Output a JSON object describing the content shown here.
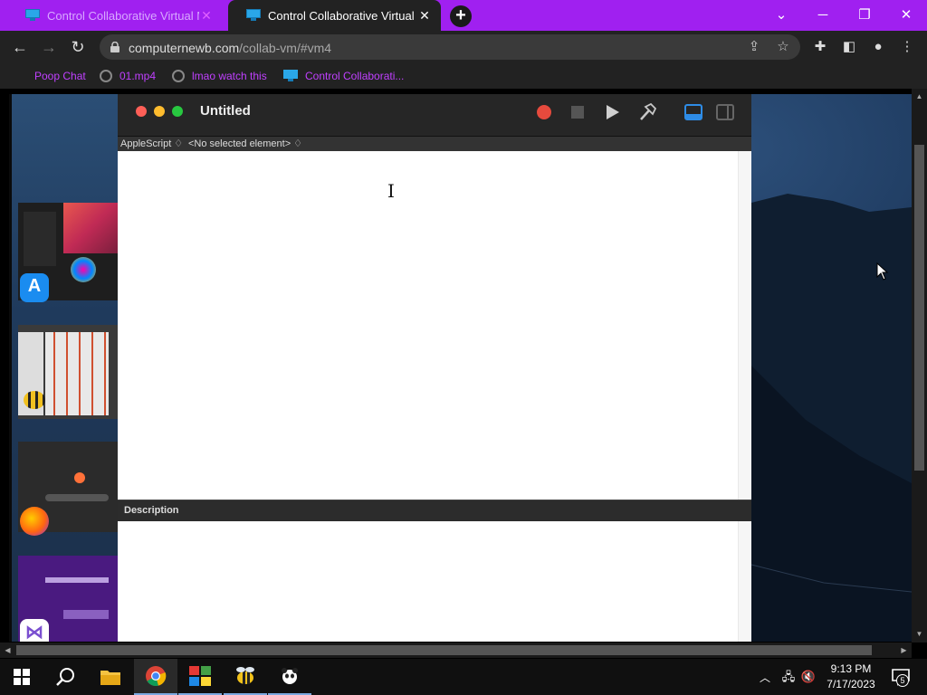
{
  "browser": {
    "tabs": [
      {
        "title": "Control Collaborative Virtual Ma",
        "active": false
      },
      {
        "title": "Control Collaborative Virtual Ma",
        "active": true
      }
    ],
    "url_host": "computernewb.com",
    "url_path": "/collab-vm/#vm4",
    "bookmarks": [
      {
        "label": "Poop Chat",
        "icon": "none"
      },
      {
        "label": "01.mp4",
        "icon": "globe-icon"
      },
      {
        "label": "lmao watch this",
        "icon": "globe-icon"
      },
      {
        "label": "Control Collaborati...",
        "icon": "monitor-icon"
      }
    ],
    "accent_color": "#a020f0"
  },
  "vm": {
    "script_editor": {
      "window_title": "Untitled",
      "language_popup": "AppleScript ♢",
      "element_popup": "<No selected element> ♢",
      "description_label": "Description"
    }
  },
  "taskbar": {
    "apps": [
      "start",
      "search",
      "file-explorer",
      "chrome",
      "paint",
      "bee-app",
      "panda-app"
    ],
    "active_app": "chrome",
    "clock_time": "9:13 PM",
    "clock_date": "7/17/2023",
    "notification_count": "5"
  }
}
